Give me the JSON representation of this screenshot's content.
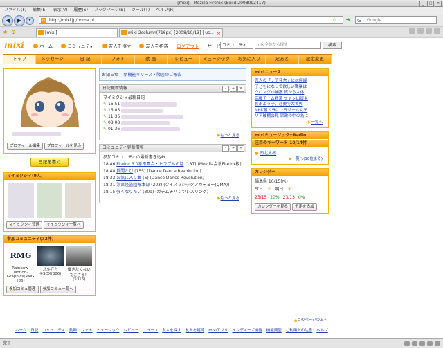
{
  "window": {
    "title": "[mixi] - Mozilla Firefox (Build 2008092417)"
  },
  "menubar": [
    "ファイル(F)",
    "編集(E)",
    "表示(V)",
    "履歴(S)",
    "ブックマーク(B)",
    "ツール(T)",
    "ヘルプ(H)"
  ],
  "navbar": {
    "url": "http://mixi.jp/home.pl",
    "search_placeholder": "Google"
  },
  "tabs": [
    {
      "label": "[mixi]"
    },
    {
      "label": "mixi-2column(716px) [2008/10/13] | us..."
    }
  ],
  "mixi": {
    "logo": "mixi",
    "topnav": [
      "ホーム",
      "コミュニティ",
      "友人を探す",
      "友人を招待",
      "ログアウト",
      "サービス一覧"
    ],
    "search_select": "コミュニティ",
    "search_placeholder": "mixi全体から探す",
    "search_button": "検索",
    "tabs": [
      "トップ",
      "メッセージ",
      "日 記",
      "フォト",
      "動 画",
      "レビュー",
      "ミュージック",
      "お気に入り",
      "足あと",
      "設定変更"
    ],
    "profile_buttons": [
      "プロフィール編集",
      "プロフィールを見る"
    ],
    "write_diary": "日記を書く",
    "mymixi": {
      "title": "マイミクシィ(9人)",
      "buttons": [
        "マイミクシィ管理",
        "マイミクシィ一覧へ"
      ]
    },
    "communities": {
      "title": "参加コミュニティ(72件)",
      "items": [
        {
          "name": "Rainbow-Motion-Graphics(RMG)(86)",
          "logo": "RMG"
        },
        {
          "name": "北斗打ち④SDX(386)",
          "logo": ""
        },
        {
          "name": "働きたくないでござる！(5316)",
          "logo": ""
        }
      ],
      "buttons": [
        "参加コミュ管理",
        "参加コミュ一覧へ"
      ]
    },
    "notice": {
      "label": "お知らせ",
      "text": "新機能リリース・障害のご報告"
    },
    "diary": {
      "header": "日記更新情報",
      "sub": "マイミクシィ最新日記",
      "times": [
        "16:51",
        "16:05",
        "11:36",
        "08:08",
        "01:36"
      ],
      "more": "もっと見る"
    },
    "community_updates": {
      "header": "コミュニティ更新情報",
      "sub": "参加コミュニティの最新書き込み",
      "rows": [
        {
          "time": "18:46",
          "title": "Firefox 3.0系不具合・トラブルの話",
          "count": "(187)",
          "comm": "(Mozilla会系Firefox板)"
        },
        {
          "time": "18:40",
          "title": "質問とび",
          "count": "(155)",
          "comm": "(Dance Dance Revolution)"
        },
        {
          "time": "18:33",
          "title": "お気に入り曲",
          "count": "(6)",
          "comm": "(Dance Dance Revolution)"
        },
        {
          "time": "18:31",
          "title": "涼宮怪盗団報本部",
          "count": "(203)",
          "comm": "(クイズマジックアカデミー(QMA))"
        },
        {
          "time": "18:15",
          "title": "強くなりたい",
          "count": "(309)",
          "comm": "(ガチムチパンツレスリング)"
        }
      ],
      "more": "もっと見る"
    },
    "mixi_news": {
      "header": "mixiニュース",
      "items": [
        "恋人の「ナチ発言」には無縁",
        "子どもになって欲しい職業は",
        "クロマグロ捕獲 資から人体",
        "応援チーム救済 ファン出資を",
        "長永よう子、恋愛で大喪失",
        "NHK朝ドラにフラザーム女子",
        "リア破棚会見 家政の中の為に"
      ],
      "more": "一覧へ"
    },
    "music": {
      "header": "mixiミュージック+Radio",
      "keyword_header": "注目のキーワード 10/14付",
      "keyword": "南北大根",
      "more": "一覧へ(10位まで)"
    },
    "calendar": {
      "header": "カレンダー",
      "date": "福島県 10/15(水)",
      "today": "今日",
      "tomorrow": "明日",
      "today_temp": "23/15",
      "today_pct": "20%",
      "tomorrow_temp": "23/13",
      "tomorrow_pct": "0%",
      "buttons": [
        "カレンダーを見る",
        "予定を追加"
      ]
    },
    "page_top": "このページの上へ",
    "footer": [
      "ホーム",
      "日記",
      "コミュニティ",
      "動画",
      "フォト",
      "ミュージック",
      "レビュー",
      "ニュース",
      "友人を探す",
      "友人を招待",
      "mixiアプリ",
      "インディーズ機能",
      "機能要望",
      "ご利用上の注意",
      "ヘルプ"
    ]
  },
  "status": {
    "text": "完了"
  }
}
